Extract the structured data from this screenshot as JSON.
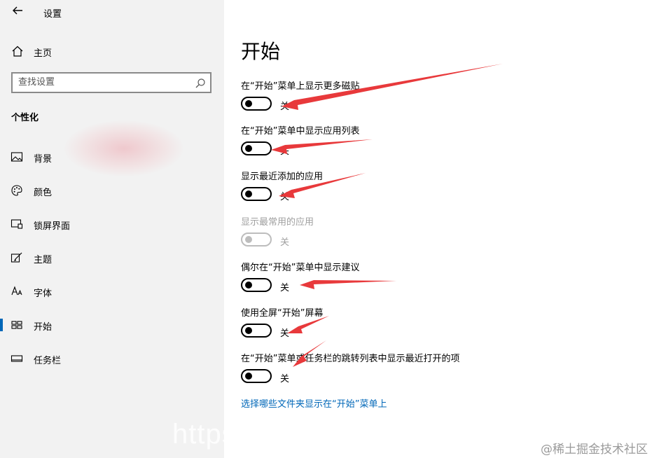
{
  "header": {
    "title": "设置"
  },
  "sidebar": {
    "home_label": "主页",
    "search": {
      "placeholder": "查找设置",
      "value": ""
    },
    "section_title": "个性化",
    "items": [
      {
        "label": "背景",
        "icon": "picture-icon"
      },
      {
        "label": "颜色",
        "icon": "palette-icon"
      },
      {
        "label": "锁屏界面",
        "icon": "lock-screen-icon"
      },
      {
        "label": "主题",
        "icon": "theme-brush-icon"
      },
      {
        "label": "字体",
        "icon": "font-icon"
      },
      {
        "label": "开始",
        "icon": "start-icon",
        "active": true
      },
      {
        "label": "任务栏",
        "icon": "taskbar-icon"
      }
    ]
  },
  "main": {
    "title": "开始",
    "settings": [
      {
        "label": "在“开始”菜单上显示更多磁贴",
        "state": "关",
        "on": false,
        "enabled": true
      },
      {
        "label": "在“开始”菜单中显示应用列表",
        "state": "关",
        "on": false,
        "enabled": true
      },
      {
        "label": "显示最近添加的应用",
        "state": "关",
        "on": false,
        "enabled": true
      },
      {
        "label": "显示最常用的应用",
        "state": "关",
        "on": false,
        "enabled": false
      },
      {
        "label": "偶尔在“开始”菜单中显示建议",
        "state": "关",
        "on": false,
        "enabled": true
      },
      {
        "label": "使用全屏“开始”屏幕",
        "state": "关",
        "on": false,
        "enabled": true
      },
      {
        "label": "在“开始”菜单或任务栏的跳转列表中显示最近打开的项",
        "state": "关",
        "on": false,
        "enabled": true
      }
    ],
    "folders_link": "选择哪些文件夹显示在“开始”菜单上"
  },
  "watermarks": {
    "left": "https",
    "right": "@稀土掘金技术社区"
  },
  "colors": {
    "accent": "#0067b8",
    "sidebar_bg": "#f2f2f2",
    "arrow": "#e8393b"
  }
}
